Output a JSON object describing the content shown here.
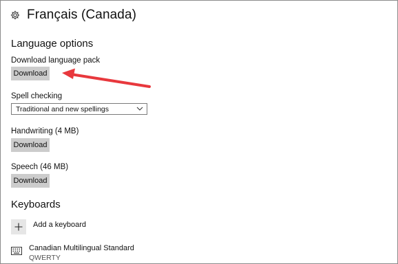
{
  "header": {
    "icon": "gear-icon",
    "title": "Français (Canada)"
  },
  "language_options": {
    "heading": "Language options",
    "download_pack": {
      "label": "Download language pack",
      "button": "Download"
    },
    "spell_checking": {
      "label": "Spell checking",
      "selected": "Traditional and new spellings"
    },
    "handwriting": {
      "label": "Handwriting (4 MB)",
      "button": "Download"
    },
    "speech": {
      "label": "Speech (46 MB)",
      "button": "Download"
    }
  },
  "keyboards": {
    "heading": "Keyboards",
    "add_label": "Add a keyboard",
    "items": [
      {
        "name": "Canadian Multilingual Standard",
        "layout": "QWERTY"
      }
    ]
  },
  "annotation": {
    "arrow_color": "#e8383d"
  },
  "colors": {
    "button_bg": "#cccccc",
    "border": "#8a8a8a"
  }
}
